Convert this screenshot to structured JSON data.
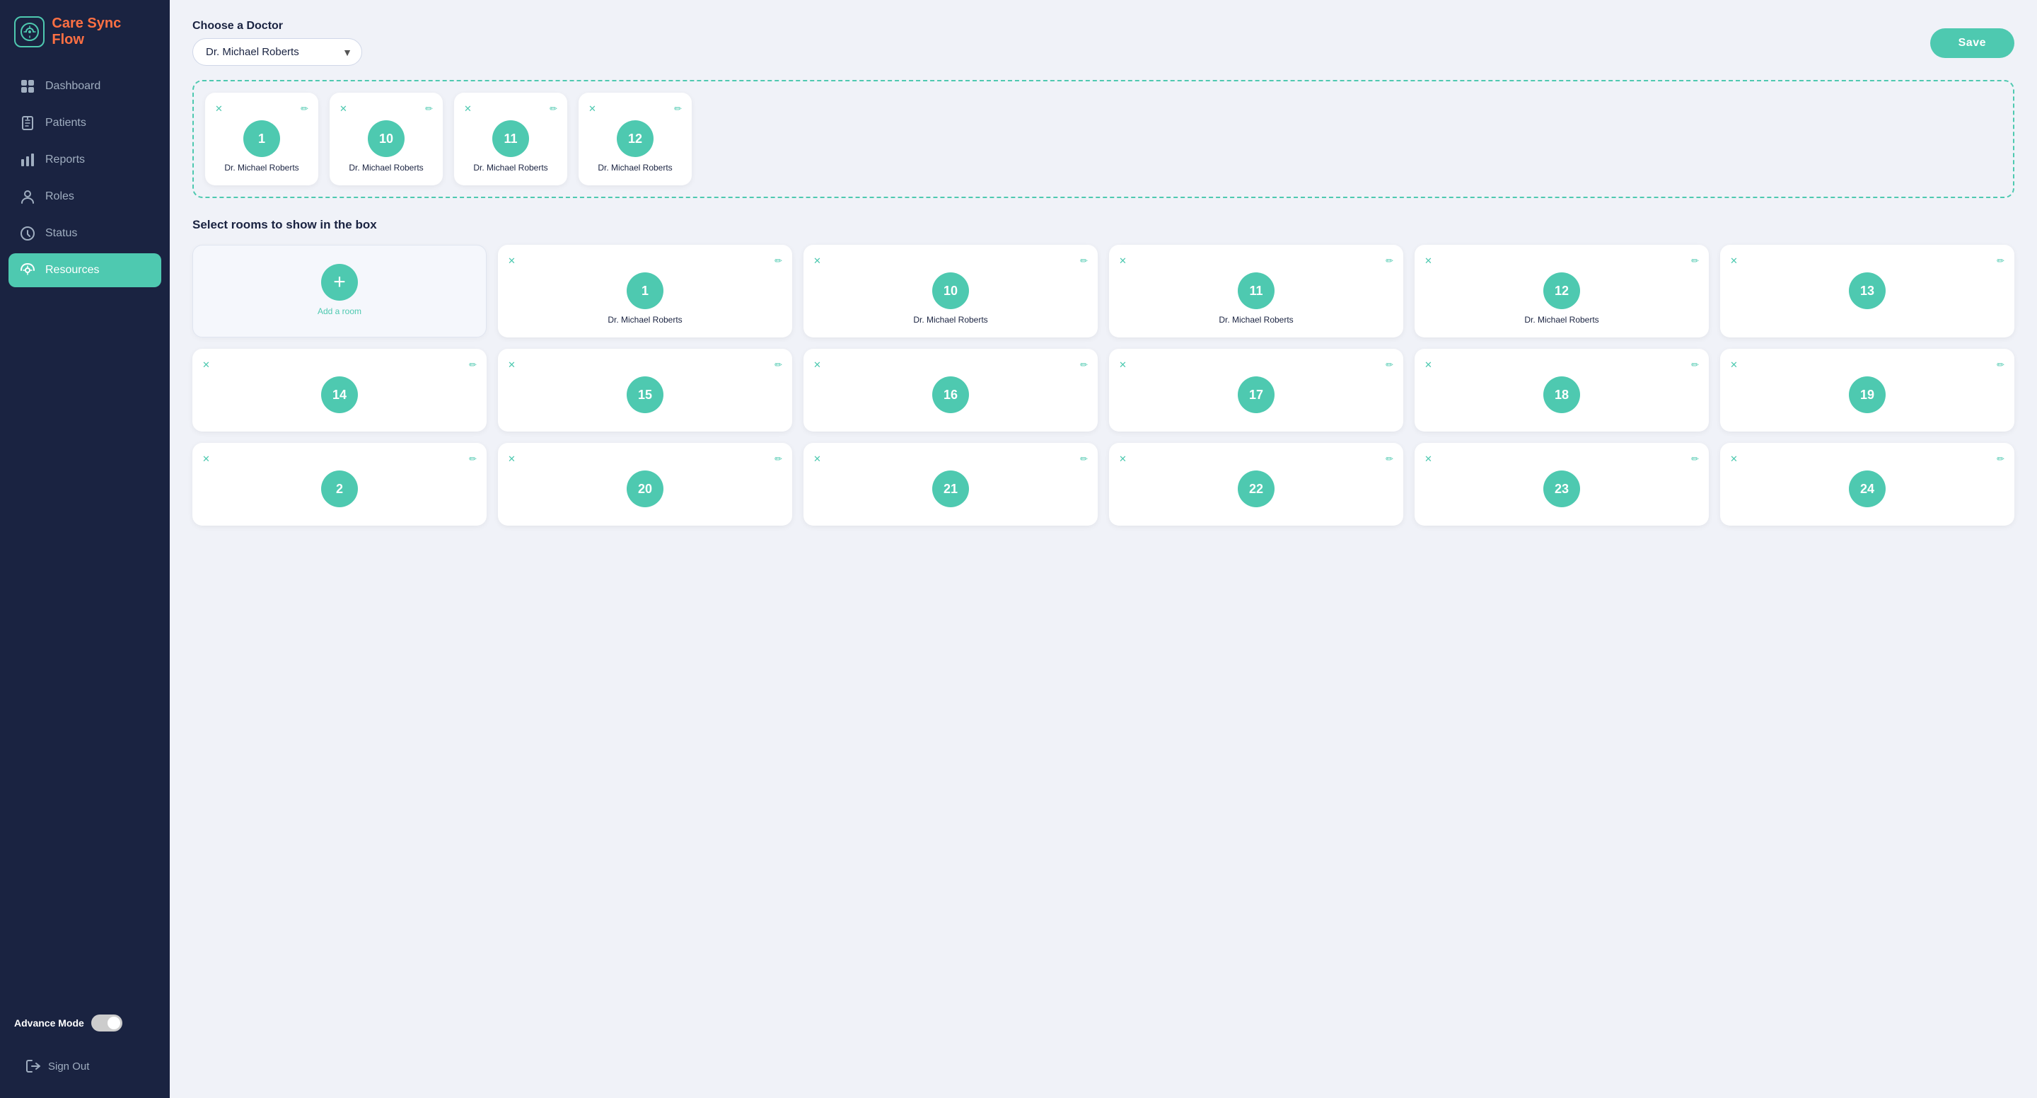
{
  "app": {
    "name_white": "Care Sync ",
    "name_orange": "Flow"
  },
  "sidebar": {
    "nav_items": [
      {
        "id": "dashboard",
        "label": "Dashboard",
        "icon": "dashboard-icon",
        "active": false
      },
      {
        "id": "patients",
        "label": "Patients",
        "icon": "patients-icon",
        "active": false
      },
      {
        "id": "reports",
        "label": "Reports",
        "icon": "reports-icon",
        "active": false
      },
      {
        "id": "roles",
        "label": "Roles",
        "icon": "roles-icon",
        "active": false
      },
      {
        "id": "status",
        "label": "Status",
        "icon": "status-icon",
        "active": false
      },
      {
        "id": "resources",
        "label": "Resources",
        "icon": "resources-icon",
        "active": true
      }
    ],
    "advance_mode_label": "Advance Mode",
    "sign_out_label": "Sign Out"
  },
  "main": {
    "choose_doctor_label": "Choose a Doctor",
    "doctor_value": "Dr. Michael Roberts",
    "save_label": "Save",
    "selected_rooms_section": {
      "rooms": [
        {
          "number": "1",
          "name": "Dr. Michael Roberts"
        },
        {
          "number": "10",
          "name": "Dr. Michael Roberts"
        },
        {
          "number": "11",
          "name": "Dr. Michael Roberts"
        },
        {
          "number": "12",
          "name": "Dr. Michael Roberts"
        }
      ]
    },
    "rooms_section_label": "Select rooms to show in the box",
    "all_rooms": [
      {
        "type": "add",
        "label": "Add a room"
      },
      {
        "type": "room",
        "number": "1",
        "name": "Dr. Michael Roberts"
      },
      {
        "type": "room",
        "number": "10",
        "name": "Dr. Michael Roberts"
      },
      {
        "type": "room",
        "number": "11",
        "name": "Dr. Michael Roberts"
      },
      {
        "type": "room",
        "number": "12",
        "name": "Dr. Michael Roberts"
      },
      {
        "type": "room",
        "number": "13",
        "name": ""
      },
      {
        "type": "room",
        "number": "14",
        "name": ""
      },
      {
        "type": "room",
        "number": "15",
        "name": ""
      },
      {
        "type": "room",
        "number": "16",
        "name": ""
      },
      {
        "type": "room",
        "number": "17",
        "name": ""
      },
      {
        "type": "room",
        "number": "18",
        "name": ""
      },
      {
        "type": "room",
        "number": "19",
        "name": ""
      },
      {
        "type": "room",
        "number": "2",
        "name": ""
      },
      {
        "type": "room",
        "number": "20",
        "name": ""
      },
      {
        "type": "room",
        "number": "21",
        "name": ""
      },
      {
        "type": "room",
        "number": "22",
        "name": ""
      },
      {
        "type": "room",
        "number": "23",
        "name": ""
      },
      {
        "type": "room",
        "number": "24",
        "name": ""
      }
    ]
  }
}
